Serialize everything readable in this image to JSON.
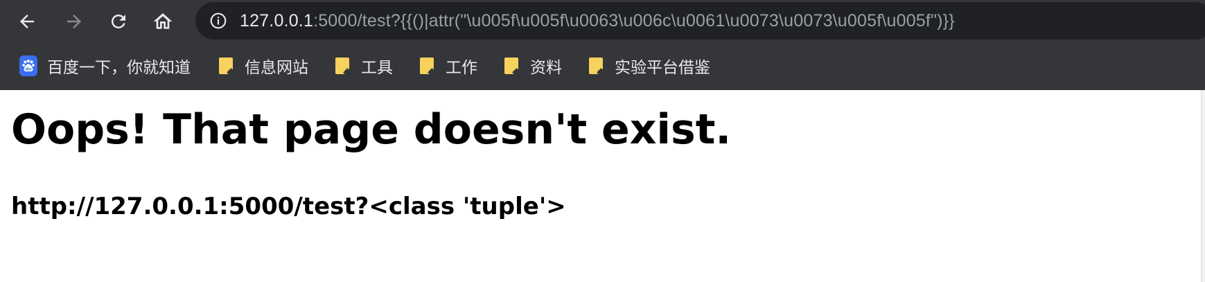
{
  "browser": {
    "chrome_color": "#35363a",
    "omnibox_color": "#202124",
    "url_host": "127.0.0.1",
    "url_rest": ":5000/test?{{()|attr(\"\\u005f\\u005f\\u0063\\u006c\\u0061\\u0073\\u0073\\u005f\\u005f\")}}",
    "icons": {
      "back": "back-arrow-icon",
      "forward": "forward-arrow-icon",
      "reload": "reload-icon",
      "home": "home-icon",
      "info": "info-icon"
    }
  },
  "bookmarks": [
    {
      "label": "百度一下，你就知道",
      "icon": "baidu-paw-icon"
    },
    {
      "label": "信息网站",
      "icon": "folder-icon"
    },
    {
      "label": "工具",
      "icon": "folder-icon"
    },
    {
      "label": "工作",
      "icon": "folder-icon"
    },
    {
      "label": "资料",
      "icon": "folder-icon"
    },
    {
      "label": "实验平台借鉴",
      "icon": "folder-icon"
    }
  ],
  "page": {
    "title": "Oops! That page doesn't exist.",
    "url_line": "http://127.0.0.1:5000/test?<class 'tuple'>"
  }
}
